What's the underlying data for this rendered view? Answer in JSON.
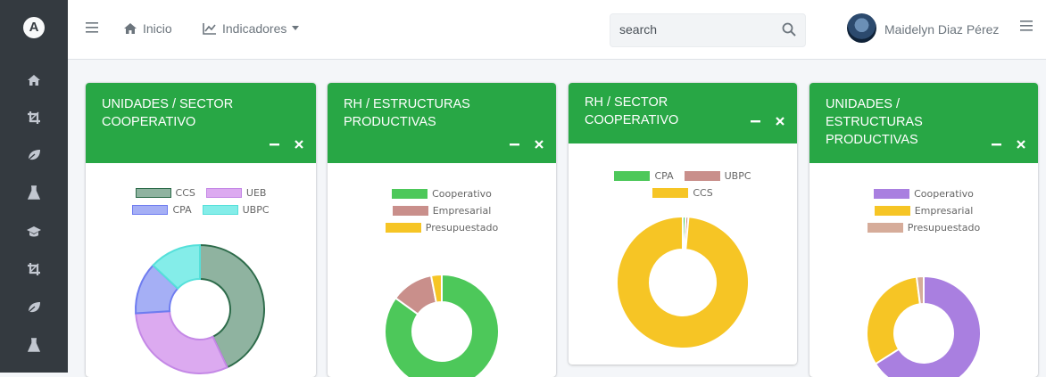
{
  "sidebar": {
    "brand": "A",
    "items": [
      {
        "icon": "home-icon"
      },
      {
        "icon": "crop-icon"
      },
      {
        "icon": "leaf-icon"
      },
      {
        "icon": "flask-icon"
      },
      {
        "icon": "graduation-cap-icon"
      },
      {
        "icon": "crop-icon"
      },
      {
        "icon": "leaf-icon"
      },
      {
        "icon": "flask-icon"
      }
    ]
  },
  "topbar": {
    "nav_inicio": "Inicio",
    "nav_indicadores": "Indicadores",
    "search_placeholder": "search",
    "user_name": "Maidelyn Diaz Pérez"
  },
  "cards": [
    {
      "title": "UNIDADES / SECTOR COOPERATIVO",
      "legend_rows": [
        [
          "CCS",
          "UEB"
        ],
        [
          "CPA",
          "UBPC"
        ]
      ],
      "chart_data": {
        "type": "pie",
        "labels": [
          "CCS",
          "UEB",
          "CPA",
          "UBPC"
        ],
        "values": [
          43,
          31,
          13,
          13
        ],
        "colors": [
          "#8fb3a0",
          "#dcaaf0",
          "#a5aff5",
          "#84ede9"
        ],
        "borders": [
          "#2d6b4a",
          "#c488e6",
          "#6e7cf0",
          "#55e0da"
        ]
      }
    },
    {
      "title": "RH / ESTRUCTURAS PRODUCTIVAS",
      "legend_rows": [
        [
          "Cooperativo"
        ],
        [
          "Empresarial"
        ],
        [
          "Presupuestado"
        ]
      ],
      "chart_data": {
        "type": "pie",
        "labels": [
          "Cooperativo",
          "Empresarial",
          "Presupuestado"
        ],
        "values": [
          85,
          12,
          3
        ],
        "colors": [
          "#4dc85a",
          "#c98f8b",
          "#f6c525"
        ],
        "borders": [
          "#ffffff",
          "#ffffff",
          "#ffffff"
        ]
      }
    },
    {
      "title": "RH / SECTOR COOPERATIVO",
      "legend_rows": [
        [
          "CPA",
          "UBPC"
        ],
        [
          "CCS"
        ]
      ],
      "chart_data": {
        "type": "pie",
        "labels": [
          "CPA",
          "UBPC",
          "CCS"
        ],
        "values": [
          0.7,
          0.7,
          98.6
        ],
        "colors": [
          "#4dc85a",
          "#c98f8b",
          "#f6c525"
        ],
        "borders": [
          "#ffffff",
          "#ffffff",
          "#ffffff"
        ]
      }
    },
    {
      "title": "UNIDADES / ESTRUCTURAS PRODUCTIVAS",
      "legend_rows": [
        [
          "Cooperativo"
        ],
        [
          "Empresarial"
        ],
        [
          "Presupuestado"
        ]
      ],
      "chart_data": {
        "type": "pie",
        "labels": [
          "Cooperativo",
          "Empresarial",
          "Presupuestado"
        ],
        "values": [
          66,
          32,
          2
        ],
        "colors": [
          "#a97fe0",
          "#f6c525",
          "#d6ac9a"
        ],
        "borders": [
          "#ffffff",
          "#ffffff",
          "#ffffff"
        ]
      }
    }
  ]
}
